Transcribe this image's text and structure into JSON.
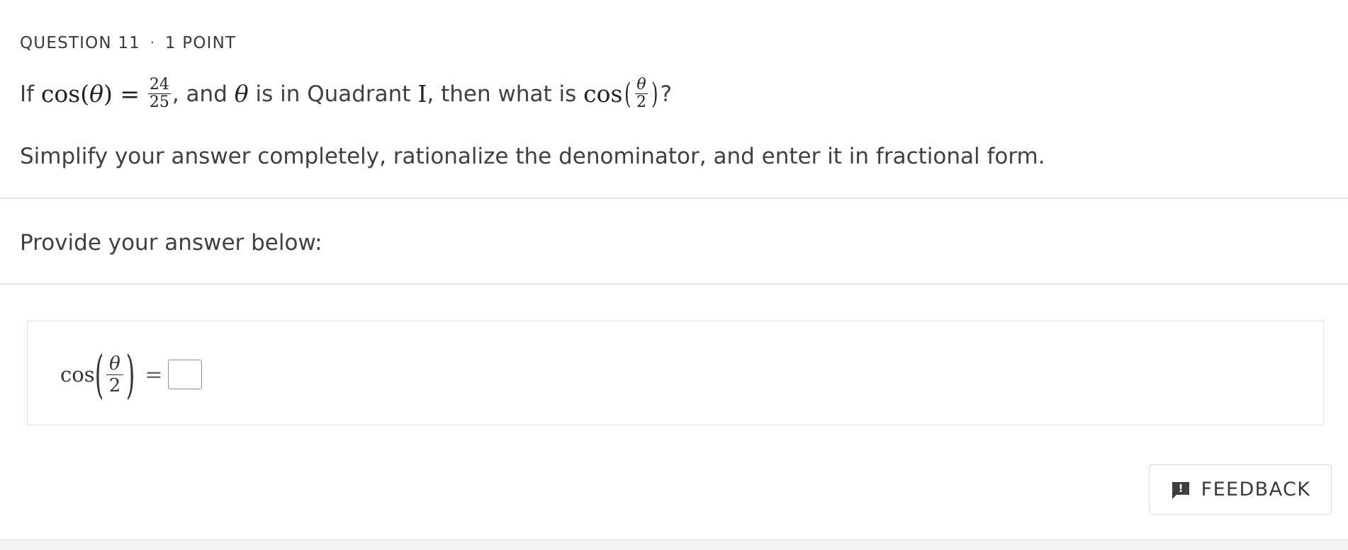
{
  "question": {
    "label": "QUESTION 11",
    "separator": "·",
    "points": "1 POINT"
  },
  "prompt": {
    "lead": "If",
    "cos_text": "cos(",
    "theta": "θ",
    "close_eq": ") =",
    "frac_num": "24",
    "frac_den": "25",
    "mid_text": ", and",
    "mid_text2": "is in Quadrant",
    "quadrant": "I",
    "tail_text": ", then what is",
    "cos2": "cos",
    "half_num": "θ",
    "half_den": "2",
    "qmark": "?"
  },
  "instructions": "Simplify your answer completely, rationalize the denominator,  and enter it in fractional form.",
  "provide_label": "Provide your answer below:",
  "answer": {
    "cos": "cos",
    "num": "θ",
    "den": "2",
    "eq": "=",
    "value": ""
  },
  "feedback": {
    "label": "FEEDBACK",
    "icon": "feedback-icon",
    "icon_mark": "!"
  }
}
